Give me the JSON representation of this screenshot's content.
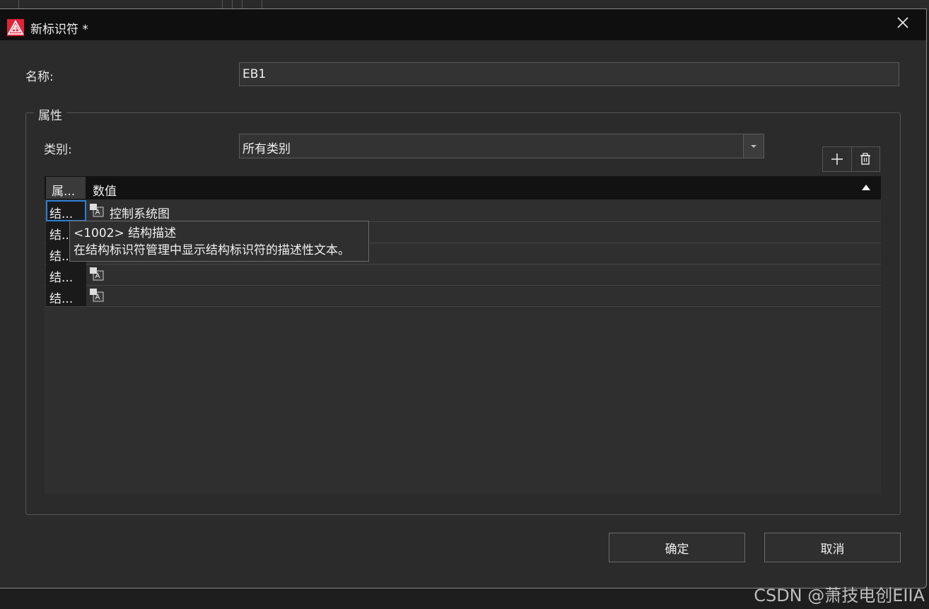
{
  "window": {
    "title": "新标识符 *"
  },
  "form": {
    "name_label": "名称:",
    "name_value": "EB1",
    "properties_group_label": "属性",
    "category_label": "类别:",
    "category_value": "所有类别"
  },
  "grid": {
    "columns": [
      "属...",
      "数值"
    ],
    "rows": [
      {
        "attr": "结...",
        "value": "控制系统图"
      },
      {
        "attr": "结...",
        "value": ""
      },
      {
        "attr": "结...",
        "value": ""
      },
      {
        "attr": "结...",
        "value": ""
      },
      {
        "attr": "结...",
        "value": ""
      }
    ]
  },
  "tooltip": {
    "line1": "<1002> 结构描述",
    "line2": "在结构标识符管理中显示结构标识符的描述性文本。"
  },
  "buttons": {
    "ok": "确定",
    "cancel": "取消"
  },
  "watermark": "CSDN @萧技电创EIIA",
  "colors": {
    "app_icon": "#e0223b",
    "selection": "#2f7fd6"
  }
}
